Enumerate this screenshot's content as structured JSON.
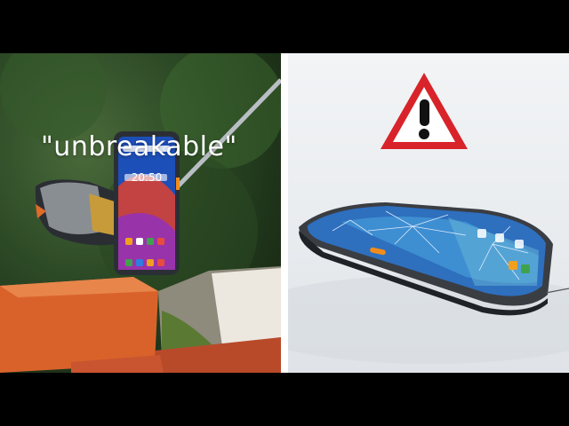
{
  "left_panel": {
    "caption": "\"unbreakable\"",
    "phone_clock": "20:50"
  },
  "right_panel": {
    "warning_icon": "warning-triangle-icon"
  },
  "colors": {
    "warning_red": "#d8232a",
    "brick": "#d9622b",
    "phone_accent_orange": "#f28c1b"
  }
}
